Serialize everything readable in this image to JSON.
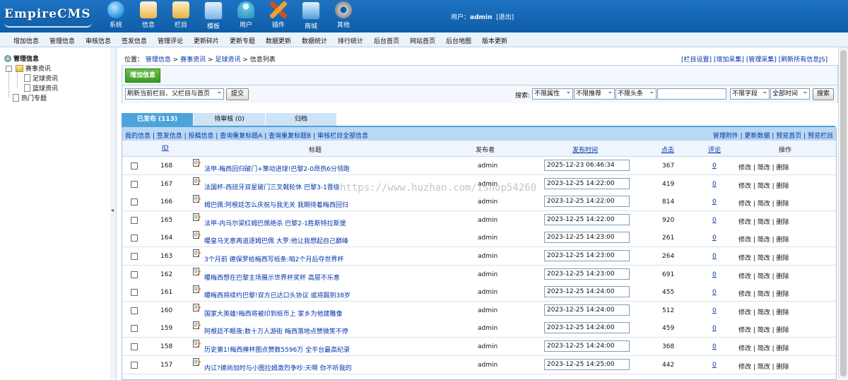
{
  "header": {
    "logo_text": "EmpireCMS",
    "icons": [
      {
        "label": "系统",
        "icon": "globe-icon",
        "color": "#3aa0e8"
      },
      {
        "label": "信息",
        "icon": "document-edit-icon",
        "color": "#f0b54a"
      },
      {
        "label": "栏目",
        "icon": "folder-icon",
        "color": "#f1c55a"
      },
      {
        "label": "模板",
        "icon": "template-icon",
        "color": "#7eb4e8"
      },
      {
        "label": "用户",
        "icon": "user-icon",
        "color": "#5bc0de"
      },
      {
        "label": "插件",
        "icon": "tools-icon",
        "color": "#f0a030"
      },
      {
        "label": "商城",
        "icon": "shop-icon",
        "color": "#4fa0e0"
      },
      {
        "label": "其他",
        "icon": "gear-icon",
        "color": "#c9c9c9"
      }
    ],
    "user_prefix": "用户：",
    "username": "admin",
    "logout": "[退出]"
  },
  "menubar": [
    "增加信息",
    "管理信息",
    "审核信息",
    "签发信息",
    "管理评论",
    "更新碎片",
    "更新专题",
    "数据更新",
    "数据统计",
    "排行统计",
    "后台首页",
    "网站首页",
    "后台地图",
    "版本更新"
  ],
  "tree": {
    "root": "管理信息",
    "node": "赛事资讯",
    "children": [
      "足球资讯",
      "篮球资讯"
    ],
    "other": "热门专题"
  },
  "crumb": {
    "prefix": "位置：",
    "links": [
      "管理信息",
      "赛事资讯",
      "足球资讯"
    ],
    "sep": " > ",
    "current": "信息列表"
  },
  "toplinks": [
    "[栏目设置]",
    "[增加采集]",
    "[管理采集]",
    "[刷新所有信息JS]"
  ],
  "actions": {
    "add": "增加信息",
    "refresh_select": "刷新当前栏目、父栏目与首页",
    "submit": "提交",
    "search_label": "搜索:",
    "filters": [
      "不限属性",
      "不限推荐",
      "不限头条"
    ],
    "field": "不限字段",
    "time": "全部时间",
    "search_btn": "搜索",
    "search_value": ""
  },
  "tabs": [
    "已发布 (113)",
    "待审核 (0)",
    "归档"
  ],
  "linkbar": {
    "left": "我的信息 | 签发信息 | 投稿信息 | 查询重复标题A | 查询重复标题B | 审核栏目全部信息",
    "right": "管理附件 | 更新数据 | 预览首页 | 预览栏目"
  },
  "columns": {
    "id": "ID",
    "title": "标题",
    "publisher": "发布者",
    "time": "发布时间",
    "hits": "点击",
    "comments": "评论",
    "ops": "操作"
  },
  "ops_text": "修改 | 简改 | 删除",
  "rows": [
    {
      "id": "168",
      "title": "法甲-梅西回归破门+策动进球!巴黎2-0昂热6分领跑",
      "publisher": "admin",
      "time": "2025-12-23 06:46:34",
      "hits": "367",
      "comments": "0"
    },
    {
      "id": "167",
      "title": "法国杯-西班牙双星破门三叉戟轮休 巴黎3-1晋级",
      "publisher": "admin",
      "time": "2023-12-25 14:22:00",
      "hits": "419",
      "comments": "0"
    },
    {
      "id": "166",
      "title": "姆巴佩:阿根廷怎么庆祝与我无关 我期待着梅西回归",
      "publisher": "admin",
      "time": "2023-12-25 14:22:00",
      "hits": "814",
      "comments": "0"
    },
    {
      "id": "165",
      "title": "法甲-内马尔梁红姆巴佩绝杀 巴黎2-1胜斯特拉斯堡",
      "publisher": "admin",
      "time": "2023-12-25 14:22:00",
      "hits": "920",
      "comments": "0"
    },
    {
      "id": "164",
      "title": "曝皇马无意再追逐姆巴佩 大罗:他让我想起自己巅峰",
      "publisher": "admin",
      "time": "2023-12-25 14:23:00",
      "hits": "261",
      "comments": "0"
    },
    {
      "id": "163",
      "title": "3个月前 德保罗给梅西写纸条:咱2个月后夺世界杯",
      "publisher": "admin",
      "time": "2023-12-25 14:23:00",
      "hits": "264",
      "comments": "0"
    },
    {
      "id": "162",
      "title": "曝梅西想在巴黎主场展示世界杯奖杯 高层不乐意",
      "publisher": "admin",
      "time": "2023-12-25 14:23:00",
      "hits": "691",
      "comments": "0"
    },
    {
      "id": "161",
      "title": "曝梅西将续约巴黎!双方已达口头协议 或将踢到38岁",
      "publisher": "admin",
      "time": "2023-12-25 14:24:00",
      "hits": "455",
      "comments": "0"
    },
    {
      "id": "160",
      "title": "国家大英雄!梅西将被印到纸币上 家乡为他建雕像",
      "publisher": "admin",
      "time": "2023-12-25 14:24:00",
      "hits": "512",
      "comments": "0"
    },
    {
      "id": "159",
      "title": "阿根廷不眠夜:数十万人游街 梅西落地点赞微笑不停",
      "publisher": "admin",
      "time": "2023-12-25 14:24:00",
      "hits": "459",
      "comments": "0"
    },
    {
      "id": "158",
      "title": "历史第1!梅西捧杯图点赞数5596万 全平台最高纪录",
      "publisher": "admin",
      "time": "2023-12-25 14:24:00",
      "hits": "368",
      "comments": "0"
    },
    {
      "id": "157",
      "title": "内讧?德尚加时与小图拉姆激烈争吵:天啊 你不听我的",
      "publisher": "admin",
      "time": "2023-12-25 14:25:00",
      "hits": "442",
      "comments": "0"
    }
  ],
  "watermark": "https://www.huzhan.com/ishop54260"
}
